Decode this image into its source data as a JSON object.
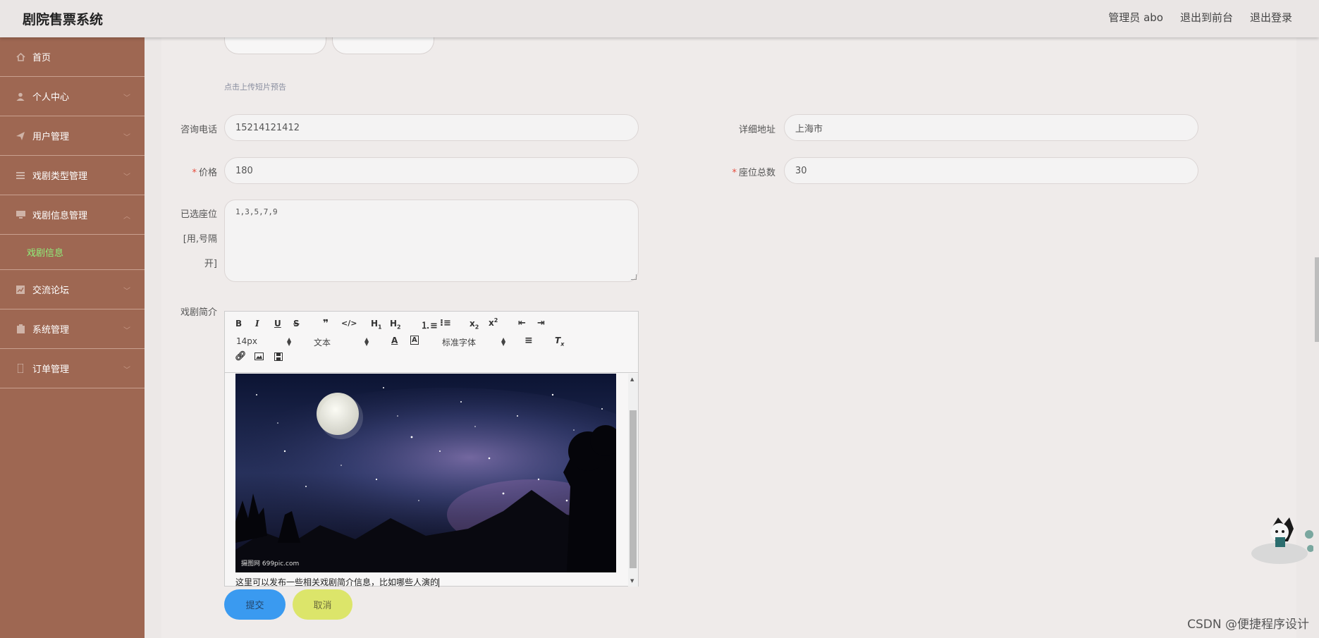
{
  "app": {
    "title": "剧院售票系统"
  },
  "topbar": {
    "user": "管理员 abo",
    "to_front": "退出到前台",
    "logout": "退出登录"
  },
  "sidebar": {
    "items": [
      {
        "label": "首页",
        "icon": "home-icon"
      },
      {
        "label": "个人中心",
        "icon": "user-icon"
      },
      {
        "label": "用户管理",
        "icon": "paper-plane-icon"
      },
      {
        "label": "戏剧类型管理",
        "icon": "list-icon"
      },
      {
        "label": "戏剧信息管理",
        "icon": "monitor-icon"
      },
      {
        "label": "交流论坛",
        "icon": "chart-icon"
      },
      {
        "label": "系统管理",
        "icon": "clipboard-icon"
      },
      {
        "label": "订单管理",
        "icon": "phone-icon"
      }
    ],
    "active_sub": "戏剧信息"
  },
  "form": {
    "upload_hint": "点击上传短片预告",
    "phone": {
      "label": "咨询电话",
      "value": "15214121412"
    },
    "address": {
      "label": "详细地址",
      "value": "上海市"
    },
    "price": {
      "label": "价格",
      "value": "180"
    },
    "seats": {
      "label": "座位总数",
      "value": "30"
    },
    "selected": {
      "label1": "已选座位",
      "label2": "[用,号隔",
      "label3": "开]",
      "value": "1,3,5,7,9"
    },
    "intro": {
      "label": "戏剧简介"
    }
  },
  "editor": {
    "font_size": "14px",
    "heading": "文本",
    "font_family": "标准字体",
    "body_text": "这里可以发布一些相关戏剧简介信息，比如哪些人演的",
    "image_watermark": "摄图网 699pic.com"
  },
  "buttons": {
    "submit": "提交",
    "cancel": "取消"
  },
  "watermark": "CSDN @便捷程序设计"
}
